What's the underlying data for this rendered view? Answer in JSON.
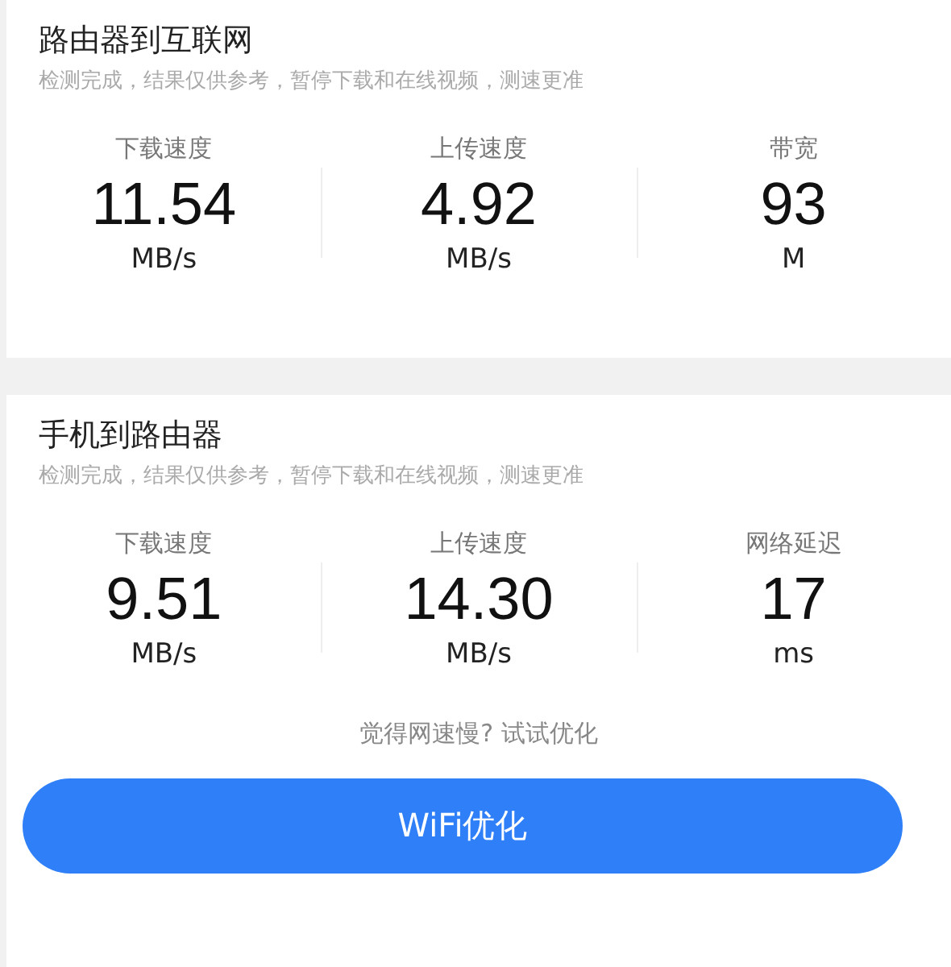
{
  "sections": [
    {
      "title": "路由器到互联网",
      "note": "检测完成，结果仅供参考，暂停下载和在线视频，测速更准",
      "metrics": [
        {
          "label": "下载速度",
          "value": "11.54",
          "unit": "MB/s"
        },
        {
          "label": "上传速度",
          "value": "4.92",
          "unit": "MB/s"
        },
        {
          "label": "带宽",
          "value": "93",
          "unit": "M"
        }
      ]
    },
    {
      "title": "手机到路由器",
      "note": "检测完成，结果仅供参考，暂停下载和在线视频，测速更准",
      "metrics": [
        {
          "label": "下载速度",
          "value": "9.51",
          "unit": "MB/s"
        },
        {
          "label": "上传速度",
          "value": "14.30",
          "unit": "MB/s"
        },
        {
          "label": "网络延迟",
          "value": "17",
          "unit": "ms"
        }
      ]
    }
  ],
  "hint": "觉得网速慢? 试试优化",
  "button": "WiFi优化"
}
